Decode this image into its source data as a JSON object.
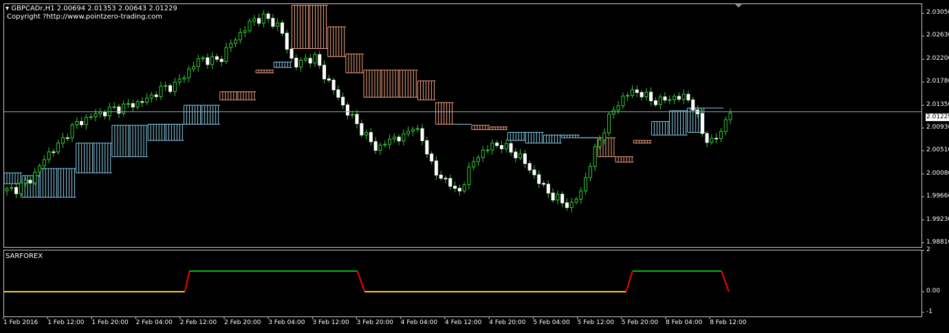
{
  "header": {
    "symbol": "GBPCADr,H1",
    "ohlc": "2.00694 2.01353 2.00643 2.01229",
    "copyright": "Copyright ?http://www.pointzero-trading.com"
  },
  "indicator_pane": {
    "title": "SARFOREX"
  },
  "colors": {
    "background": "#000000",
    "bull_candle": "#33cc33",
    "bear_candle": "#ffffff",
    "cloud_bull": "#87ceeb",
    "cloud_bear": "#f4a582",
    "bid_line": "#8fa8b8",
    "ind_up": "#00c000",
    "ind_down": "#ffd700",
    "ind_switch": "#ff0000"
  },
  "current_price": "2.01229",
  "chart_data": [
    {
      "type": "candlestick",
      "title": "GBPCADr,H1",
      "price_ticks": [
        "2.03050",
        "2.02630",
        "2.02200",
        "2.01780",
        "2.01350",
        "2.00930",
        "2.00510",
        "2.00080",
        "1.99660",
        "1.99230",
        "1.98810"
      ],
      "time_ticks": [
        "1 Feb 2016",
        "1 Feb 12:00",
        "1 Feb 20:00",
        "2 Feb 04:00",
        "2 Feb 12:00",
        "2 Feb 20:00",
        "3 Feb 04:00",
        "3 Feb 12:00",
        "3 Feb 20:00",
        "4 Feb 04:00",
        "4 Feb 12:00",
        "4 Feb 20:00",
        "5 Feb 04:00",
        "5 Feb 12:00",
        "5 Feb 20:00",
        "8 Feb 04:00",
        "8 Feb 12:00"
      ],
      "ylim": [
        1.9873,
        2.0322
      ],
      "close_path": [
        1.9977,
        1.9981,
        1.999,
        2.0004,
        2.003,
        2.0052,
        2.0062,
        2.0088,
        2.0102,
        2.011,
        2.0118,
        2.0122,
        2.0128,
        2.0131,
        2.0136,
        2.014,
        2.0147,
        2.016,
        2.0168,
        2.0172,
        2.0188,
        2.0207,
        2.0222,
        2.0218,
        2.0217,
        2.024,
        2.026,
        2.0277,
        2.0294,
        2.0297,
        2.0291,
        2.0279,
        2.0226,
        2.0207,
        2.0223,
        2.0221,
        2.019,
        2.0165,
        2.0137,
        2.0114,
        2.0094,
        2.0071,
        2.0054,
        2.0066,
        2.0077,
        2.0074,
        2.01,
        2.0072,
        2.0035,
        1.9995,
        2.0002,
        1.9965,
        2.0002,
        2.0034,
        2.0051,
        2.006,
        2.0063,
        2.005,
        2.0043,
        2.0022,
        2.0001,
        1.9979,
        1.9966,
        1.9955,
        1.995,
        1.9973,
        2.002,
        2.0067,
        2.0101,
        2.0135,
        2.015,
        2.0163,
        2.0155,
        2.0146,
        2.0141,
        2.015,
        2.0147,
        2.0154,
        2.0124,
        2.0078,
        2.0064,
        2.0091,
        2.0123
      ],
      "ichimoku_cloud": {
        "span_a": [
          2.001,
          2.0005,
          2.0018,
          2.0018,
          2.0065,
          2.0065,
          2.0098,
          2.0098,
          2.01,
          2.01,
          2.0135,
          2.0135,
          2.0145,
          2.0145,
          2.0195,
          2.0215,
          2.024,
          2.024,
          2.0225,
          2.0195,
          2.015,
          2.015,
          2.015,
          2.0145,
          2.01,
          2.01,
          2.009,
          2.009,
          2.0085,
          2.0085,
          2.008,
          2.008,
          2.0075,
          2.004,
          2.003,
          2.0065,
          2.0105,
          2.0125,
          2.013,
          2.013,
          2.013
        ],
        "span_b": [
          1.999,
          1.9965,
          1.9965,
          1.9965,
          2.001,
          2.001,
          2.004,
          2.004,
          2.007,
          2.007,
          2.01,
          2.01,
          2.016,
          2.016,
          2.02,
          2.0205,
          2.032,
          2.032,
          2.028,
          2.023,
          2.02,
          2.02,
          2.02,
          2.018,
          2.014,
          2.01,
          2.0098,
          2.0095,
          2.007,
          2.0065,
          2.0065,
          2.0075,
          2.0075,
          2.0075,
          2.004,
          2.007,
          2.008,
          2.008,
          2.0085,
          2.013,
          2.019
        ]
      }
    },
    {
      "type": "line",
      "title": "SARFOREX",
      "yticks": [
        "2",
        "0.00",
        "-1"
      ],
      "ylim": [
        -1.2,
        2.0
      ],
      "segments": [
        {
          "state": "low",
          "from": 0.0,
          "to": 0.197,
          "value": 0
        },
        {
          "state": "switch",
          "from": 0.197,
          "to": 0.202,
          "value": [
            0,
            1
          ]
        },
        {
          "state": "high",
          "from": 0.202,
          "to": 0.385,
          "value": 1
        },
        {
          "state": "switch",
          "from": 0.385,
          "to": 0.393,
          "value": [
            1,
            0
          ]
        },
        {
          "state": "low",
          "from": 0.393,
          "to": 0.678,
          "value": 0
        },
        {
          "state": "switch",
          "from": 0.678,
          "to": 0.685,
          "value": [
            0,
            1
          ]
        },
        {
          "state": "high",
          "from": 0.685,
          "to": 0.782,
          "value": 1
        },
        {
          "state": "switch",
          "from": 0.782,
          "to": 0.79,
          "value": [
            1,
            0
          ]
        }
      ]
    }
  ]
}
